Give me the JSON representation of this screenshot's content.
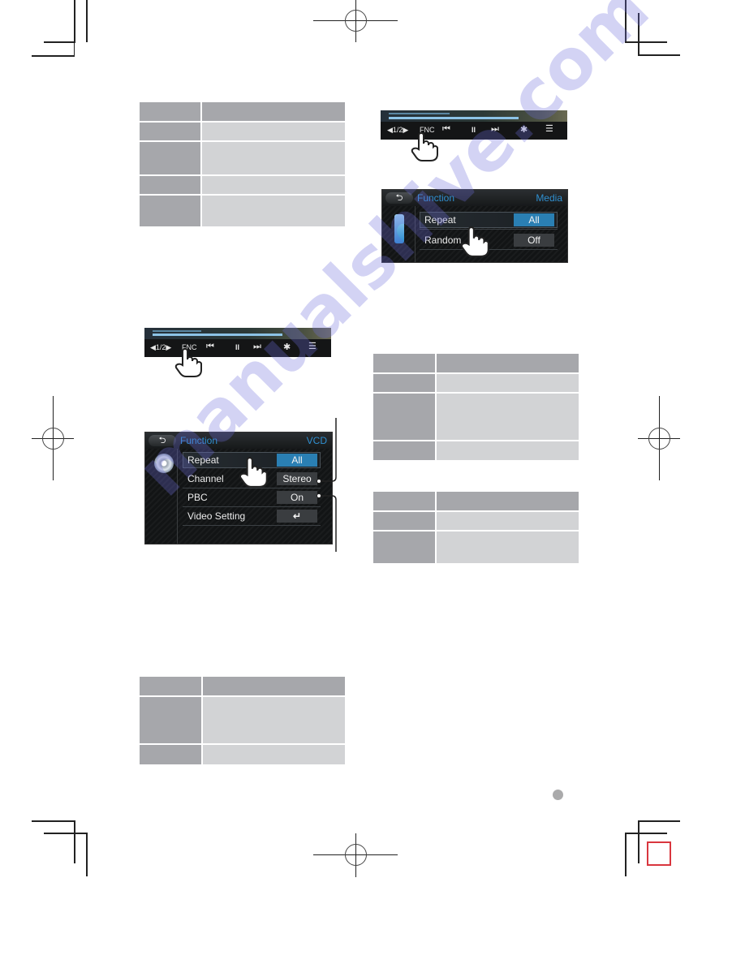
{
  "colors": {
    "table_header": "#a6a7ab",
    "table_cell": "#d2d3d5",
    "screen_accent": "#2f8fd0",
    "selected_value": "#2a7fb3",
    "trim_box": "#d9363e",
    "page_dot": "#aaaaab"
  },
  "control_bar": {
    "page_indicator": "◀1/2▶",
    "fnc_label": "FNC",
    "prev_icon": "⏮",
    "pause_icon": "II",
    "next_icon": "⏭",
    "settings_icon": "✱",
    "menu_icon": "☰"
  },
  "vcd_screen": {
    "back_icon": "⮌",
    "title": "Function",
    "source": "VCD",
    "items": [
      {
        "label": "Repeat",
        "value": "All",
        "selected": true
      },
      {
        "label": "Channel",
        "value": "Stereo",
        "selected": false
      },
      {
        "label": "PBC",
        "value": "On",
        "selected": false
      },
      {
        "label": "Video Setting",
        "value": "↵",
        "selected": false
      }
    ]
  },
  "media_screen": {
    "back_icon": "⮌",
    "title": "Function",
    "source": "Media",
    "items": [
      {
        "label": "Repeat",
        "value": "All",
        "selected": true
      },
      {
        "label": "Random",
        "value": "Off",
        "selected": false
      }
    ]
  },
  "watermark": "manualshive.com"
}
